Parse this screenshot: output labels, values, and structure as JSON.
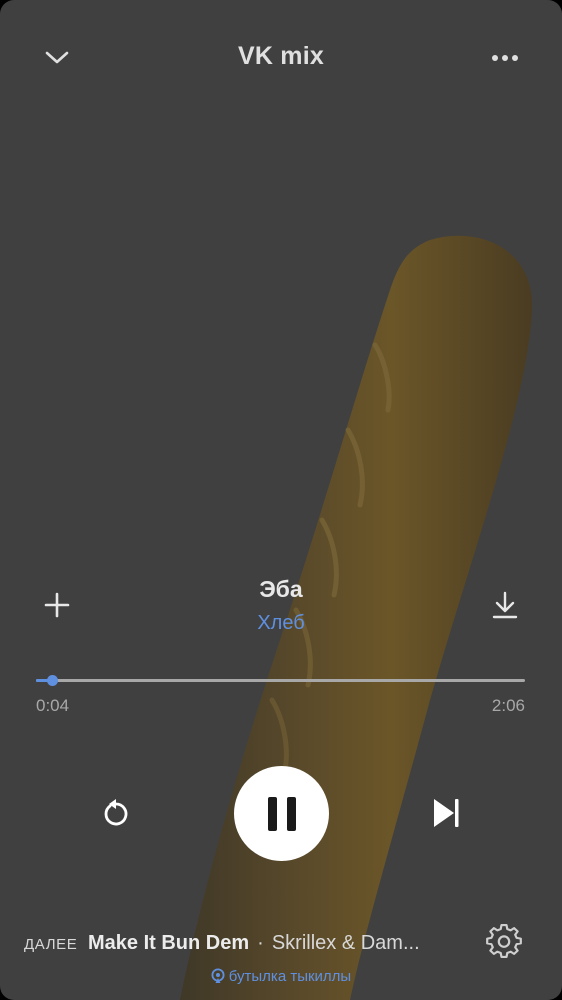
{
  "header": {
    "title": "VK mix",
    "back_icon": "chevron-down-icon",
    "more_icon": "more-horizontal-icon"
  },
  "track": {
    "title": "Эба",
    "artist": "Хлеб"
  },
  "progress": {
    "current": "0:04",
    "total": "2:06",
    "fraction": 0.032
  },
  "controls": {
    "repeat_icon": "repeat-icon",
    "pause_icon": "pause-icon",
    "next_icon": "skip-next-icon",
    "add_icon": "plus-icon",
    "download_icon": "download-icon"
  },
  "up_next": {
    "label": "ДАЛЕЕ",
    "track": "Make It Bun Dem",
    "separator": "·",
    "artist": "Skrillex & Dam..."
  },
  "broadcast": {
    "label": "бутылка тыкиллы"
  },
  "colors": {
    "background": "#404040",
    "accent": "#5f90e0",
    "text": "#e8e8e8",
    "secondary_text": "#a8a8a8"
  }
}
